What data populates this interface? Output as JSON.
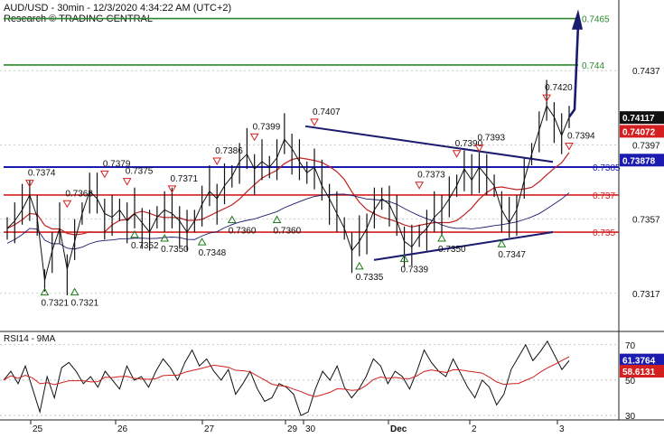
{
  "header": {
    "title": "AUD/USD - 30min - 12/3/2020 4:34:22 AM (UTC+2)",
    "source": "Research © TRADING CENTRAL"
  },
  "colors": {
    "resistance": "#2a8a2a",
    "support": "#d42020",
    "pivot": "#1b1bb0",
    "trend": "#1a1a6e",
    "ma": "#c02020",
    "price": "#111111",
    "rsi": "#111111",
    "rsi_ma": "#d02020",
    "grid": "#999999"
  },
  "chart_data": [
    {
      "type": "line",
      "name": "price",
      "ylim": [
        0.7297,
        0.7475
      ],
      "y_ticks": [
        "0.7437",
        "0.7397",
        "0.7357",
        "0.7317"
      ],
      "x_ticks": [
        "25",
        "26",
        "27",
        "29",
        "30",
        "Dec",
        "2",
        "3"
      ],
      "current_price": "0.74117",
      "ma_value": "0.74072",
      "levels": [
        {
          "label": "0.7465",
          "value": 0.7465,
          "role": "resistance"
        },
        {
          "label": "0.744",
          "value": 0.744,
          "role": "resistance"
        },
        {
          "label": "0.73878",
          "value": 0.73878,
          "role": "current-pivot"
        },
        {
          "label": "0.7385",
          "value": 0.7385,
          "role": "pivot"
        },
        {
          "label": "0.737",
          "value": 0.737,
          "role": "support"
        },
        {
          "label": "0.735",
          "value": 0.735,
          "role": "support"
        }
      ],
      "peaks": [
        "0.7374",
        "0.7363",
        "0.7379",
        "0.7375",
        "0.7371",
        "0.7386",
        "0.7399",
        "0.7407",
        "0.7373",
        "0.7390",
        "0.7393",
        "0.7420",
        "0.7394"
      ],
      "troughs": [
        "0.7321",
        "0.7321",
        "0.7352",
        "0.7350",
        "0.7348",
        "0.7360",
        "0.7360",
        "0.7335",
        "0.7339",
        "0.7350",
        "0.7347"
      ],
      "close": [
        0.7352,
        0.7356,
        0.7362,
        0.737,
        0.7358,
        0.7324,
        0.734,
        0.7352,
        0.733,
        0.7345,
        0.736,
        0.7372,
        0.7368,
        0.736,
        0.7358,
        0.7362,
        0.7356,
        0.736,
        0.7355,
        0.735,
        0.7358,
        0.7362,
        0.736,
        0.7356,
        0.735,
        0.7356,
        0.7365,
        0.7372,
        0.7368,
        0.7375,
        0.738,
        0.7388,
        0.7392,
        0.7384,
        0.7388,
        0.7385,
        0.739,
        0.74,
        0.7395,
        0.7388,
        0.7382,
        0.7385,
        0.7375,
        0.7368,
        0.736,
        0.7352,
        0.734,
        0.7345,
        0.7352,
        0.7362,
        0.7368,
        0.7365,
        0.7356,
        0.7345,
        0.7342,
        0.7348,
        0.7352,
        0.7358,
        0.7362,
        0.7368,
        0.7375,
        0.7384,
        0.7378,
        0.7385,
        0.738,
        0.7375,
        0.7362,
        0.7355,
        0.7362,
        0.7378,
        0.7392,
        0.7405,
        0.7418,
        0.7412,
        0.7402,
        0.7412
      ]
    },
    {
      "type": "line",
      "name": "RSI",
      "title": "RSI14 - 9MA",
      "ylim": [
        28,
        76
      ],
      "y_ticks": [
        "70",
        "50",
        "30"
      ],
      "rsi_value": "61.3764",
      "rsi_ma_value": "58.6131",
      "rsi": [
        50,
        55,
        48,
        58,
        45,
        32,
        52,
        40,
        57,
        60,
        55,
        48,
        52,
        46,
        55,
        50,
        45,
        58,
        50,
        52,
        46,
        55,
        62,
        57,
        50,
        60,
        67,
        58,
        62,
        55,
        50,
        56,
        42,
        48,
        55,
        45,
        38,
        40,
        48,
        46,
        42,
        30,
        32,
        45,
        55,
        50,
        58,
        46,
        40,
        45,
        52,
        62,
        58,
        48,
        55,
        52,
        45,
        55,
        67,
        60,
        55,
        52,
        62,
        54,
        46,
        40,
        50,
        46,
        36,
        42,
        56,
        63,
        70,
        61,
        66,
        72,
        64,
        56,
        61
      ]
    }
  ]
}
